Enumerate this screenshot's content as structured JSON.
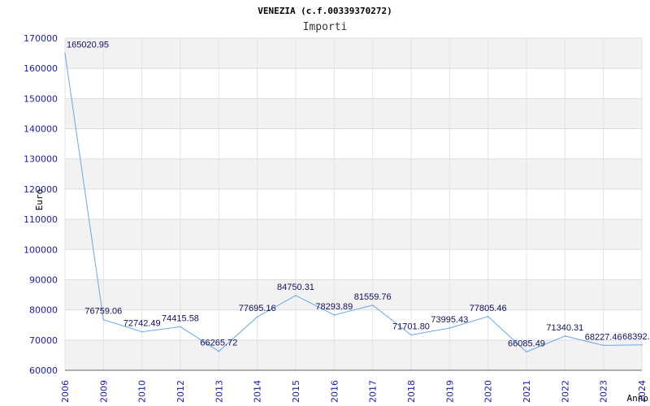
{
  "chart_data": {
    "type": "line",
    "title": "VENEZIA (c.f.00339370272)",
    "subtitle": "Importi",
    "xlabel": "Anno",
    "ylabel": "Euro",
    "categories": [
      "2006",
      "2009",
      "2010",
      "2012",
      "2013",
      "2014",
      "2015",
      "2016",
      "2017",
      "2018",
      "2019",
      "2020",
      "2021",
      "2022",
      "2023",
      "2024"
    ],
    "series": [
      {
        "values": [
          165020.95,
          76759.06,
          72742.49,
          74415.58,
          66265.72,
          77695.16,
          84750.31,
          78293.89,
          81559.76,
          71701.8,
          73995.43,
          77805.46,
          66085.49,
          71340.31,
          68227.46,
          68392.0
        ]
      }
    ],
    "data_labels": [
      "165020.95",
      "76759.06",
      "72742.49",
      "74415.58",
      "66265.72",
      "77695.16",
      "84750.31",
      "78293.89",
      "81559.76",
      "71701.80",
      "73995.43",
      "77805.46",
      "66085.49",
      "71340.31",
      "68227.46",
      "68392."
    ],
    "ylim": [
      60000,
      170000
    ],
    "yticks": [
      60000,
      70000,
      80000,
      90000,
      100000,
      110000,
      120000,
      130000,
      140000,
      150000,
      160000,
      170000
    ],
    "grid": true,
    "band_colors": [
      "#f2f2f2",
      "#ffffff"
    ],
    "line_color": "#6aa8e8"
  }
}
